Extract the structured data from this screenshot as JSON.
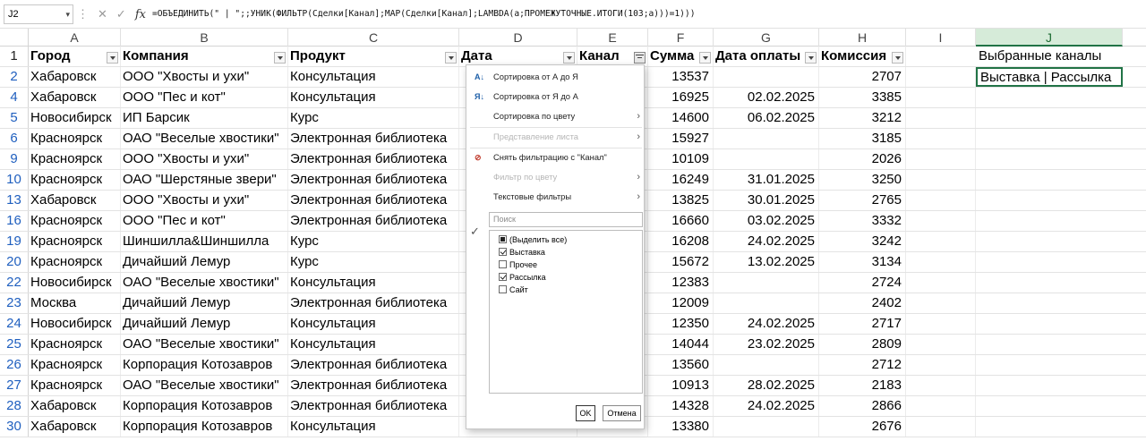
{
  "formula_bar": {
    "name_box": "J2",
    "formula": "=ОБЪЕДИНИТЬ(\" | \";;УНИК(ФИЛЬТР(Сделки[Канал];MAP(Сделки[Канал];LAMBDA(a;ПРОМЕЖУТОЧНЫЕ.ИТОГИ(103;a)))=1)))"
  },
  "columns": [
    "A",
    "B",
    "C",
    "D",
    "E",
    "F",
    "G",
    "H",
    "I",
    "J"
  ],
  "selected_column": "J",
  "header_row": {
    "num": "1",
    "cells": [
      "Город",
      "Компания",
      "Продукт",
      "Дата",
      "Канал",
      "Сумма",
      "Дата оплаты",
      "Комиссия"
    ],
    "j": "Выбранные каналы"
  },
  "rows": [
    {
      "num": "2",
      "city": "Хабаровск",
      "company": "ООО \"Хвосты и ухи\"",
      "product": "Консультация",
      "sum": "13537",
      "paid": "",
      "fee": "2707"
    },
    {
      "num": "4",
      "city": "Хабаровск",
      "company": "ООО \"Пес и кот\"",
      "product": "Консультация",
      "sum": "16925",
      "paid": "02.02.2025",
      "fee": "3385"
    },
    {
      "num": "5",
      "city": "Новосибирск",
      "company": "ИП Барсик",
      "product": "Курс",
      "sum": "14600",
      "paid": "06.02.2025",
      "fee": "3212"
    },
    {
      "num": "6",
      "city": "Красноярск",
      "company": "ОАО \"Веселые хвостики\"",
      "product": "Электронная библиотека",
      "sum": "15927",
      "paid": "",
      "fee": "3185"
    },
    {
      "num": "9",
      "city": "Красноярск",
      "company": "ООО \"Хвосты и ухи\"",
      "product": "Электронная библиотека",
      "sum": "10109",
      "paid": "",
      "fee": "2026"
    },
    {
      "num": "10",
      "city": "Красноярск",
      "company": "ОАО \"Шерстяные звери\"",
      "product": "Электронная библиотека",
      "sum": "16249",
      "paid": "31.01.2025",
      "fee": "3250"
    },
    {
      "num": "13",
      "city": "Хабаровск",
      "company": "ООО \"Хвосты и ухи\"",
      "product": "Электронная библиотека",
      "sum": "13825",
      "paid": "30.01.2025",
      "fee": "2765"
    },
    {
      "num": "16",
      "city": "Красноярск",
      "company": "ООО \"Пес и кот\"",
      "product": "Электронная библиотека",
      "sum": "16660",
      "paid": "03.02.2025",
      "fee": "3332"
    },
    {
      "num": "19",
      "city": "Красноярск",
      "company": "Шиншилла&Шиншилла",
      "product": "Курс",
      "sum": "16208",
      "paid": "24.02.2025",
      "fee": "3242"
    },
    {
      "num": "20",
      "city": "Красноярск",
      "company": "Дичайший Лемур",
      "product": "Курс",
      "sum": "15672",
      "paid": "13.02.2025",
      "fee": "3134"
    },
    {
      "num": "22",
      "city": "Новосибирск",
      "company": "ОАО \"Веселые хвостики\"",
      "product": "Консультация",
      "sum": "12383",
      "paid": "",
      "fee": "2724"
    },
    {
      "num": "23",
      "city": "Москва",
      "company": "Дичайший Лемур",
      "product": "Электронная библиотека",
      "sum": "12009",
      "paid": "",
      "fee": "2402"
    },
    {
      "num": "24",
      "city": "Новосибирск",
      "company": "Дичайший Лемур",
      "product": "Консультация",
      "sum": "12350",
      "paid": "24.02.2025",
      "fee": "2717"
    },
    {
      "num": "25",
      "city": "Красноярск",
      "company": "ОАО \"Веселые хвостики\"",
      "product": "Консультация",
      "sum": "14044",
      "paid": "23.02.2025",
      "fee": "2809"
    },
    {
      "num": "26",
      "city": "Красноярск",
      "company": "Корпорация Котозавров",
      "product": "Электронная библиотека",
      "sum": "13560",
      "paid": "",
      "fee": "2712"
    },
    {
      "num": "27",
      "city": "Красноярск",
      "company": "ОАО \"Веселые хвостики\"",
      "product": "Электронная библиотека",
      "sum": "10913",
      "paid": "28.02.2025",
      "fee": "2183"
    },
    {
      "num": "28",
      "city": "Хабаровск",
      "company": "Корпорация Котозавров",
      "product": "Электронная библиотека",
      "sum": "14328",
      "paid": "24.02.2025",
      "fee": "2866"
    },
    {
      "num": "30",
      "city": "Хабаровск",
      "company": "Корпорация Котозавров",
      "product": "Консультация",
      "sum": "13380",
      "paid": "",
      "fee": "2676"
    }
  ],
  "j2_value": "Выставка | Рассылка",
  "filter_menu": {
    "sort_az": "Сортировка от А до Я",
    "sort_za": "Сортировка от Я до А",
    "sort_color": "Сортировка по цвету",
    "sheet_view": "Представление листа",
    "clear_filter": "Снять фильтрацию с \"Канал\"",
    "filter_color": "Фильтр по цвету",
    "text_filters": "Текстовые фильтры",
    "search_placeholder": "Поиск",
    "items": [
      {
        "label": "(Выделить все)",
        "state": "partial"
      },
      {
        "label": "Выставка",
        "state": "checked"
      },
      {
        "label": "Прочее",
        "state": "unchecked"
      },
      {
        "label": "Рассылка",
        "state": "checked"
      },
      {
        "label": "Сайт",
        "state": "unchecked"
      }
    ],
    "ok": "OK",
    "cancel": "Отмена"
  },
  "colors": {
    "selection_green": "#217346",
    "row_number_blue": "#1f5fbf"
  }
}
